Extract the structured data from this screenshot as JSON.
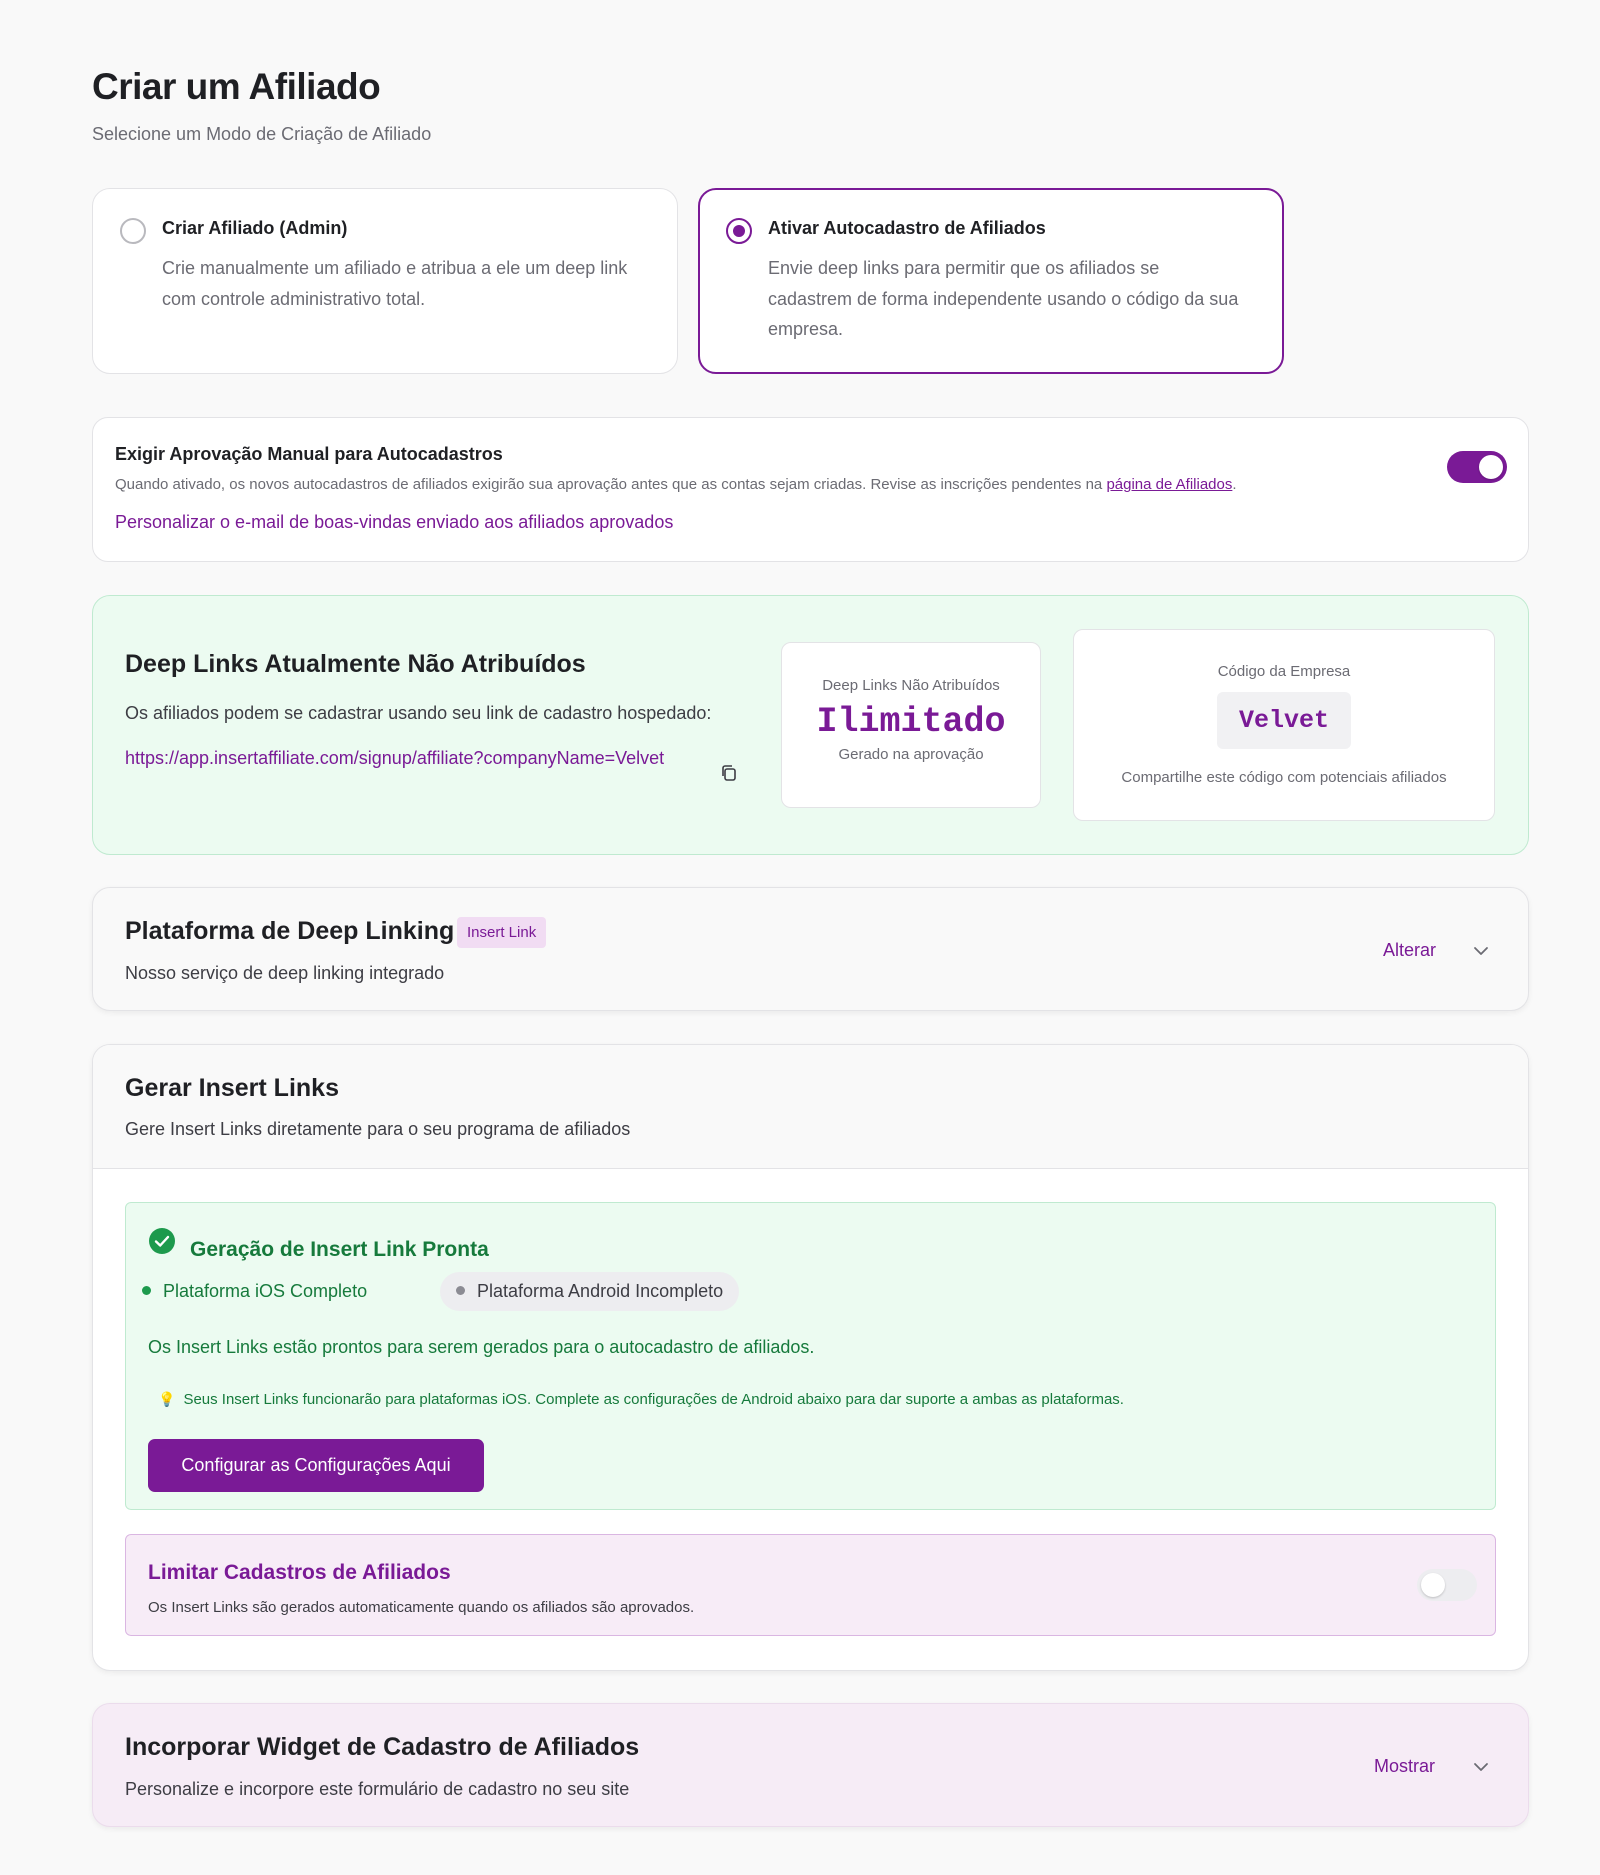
{
  "page": {
    "title": "Criar um Afiliado",
    "subtitle": "Selecione um Modo de Criação de Afiliado"
  },
  "modes": [
    {
      "title": "Criar Afiliado (Admin)",
      "description": "Crie manualmente um afiliado e atribua a ele um deep link com controle administrativo total.",
      "selected": false
    },
    {
      "title": "Ativar Autocadastro de Afiliados",
      "description": "Envie deep links para permitir que os afiliados se cadastrem de forma independente usando o código da sua empresa.",
      "selected": true
    }
  ],
  "approval": {
    "title": "Exigir Aprovação Manual para Autocadastros",
    "description": "Quando ativado, os novos autocadastros de afiliados exigirão sua aprovação antes que as contas sejam criadas. Revise as inscrições pendentes na ",
    "description_link": "página de Afiliados",
    "description_end": ".",
    "customize_link": "Personalizar o e-mail de boas-vindas enviado aos afiliados aprovados",
    "toggle_on": true
  },
  "deep_links": {
    "title": "Deep Links Atualmente Não Atribuídos",
    "description": "Os afiliados podem se cadastrar usando seu link de cadastro hospedado:",
    "signup_url": "https://app.insertaffiliate.com/signup/affiliate?companyName=Velvet",
    "unassigned_label": "Deep Links Não Atribuídos",
    "unassigned_value": "Ilimitado",
    "unassigned_note": "Gerado na aprovação",
    "company_code_label": "Código da Empresa",
    "company_code": "Velvet",
    "company_code_note": "Compartilhe este código com potenciais afiliados"
  },
  "platform": {
    "title": "Plataforma de Deep Linking",
    "badge": "Insert Link",
    "description": "Nosso serviço de deep linking integrado",
    "action": "Alterar"
  },
  "generate": {
    "title": "Gerar Insert Links",
    "description": "Gere Insert Links diretamente para o seu programa de afiliados",
    "ready_title": "Geração de Insert Link Pronta",
    "ios_status": "Plataforma iOS Completo",
    "android_status": "Plataforma Android Incompleto",
    "ready_description": "Os Insert Links estão prontos para serem gerados para o autocadastro de afiliados.",
    "tip_icon": "💡",
    "tip": "Seus Insert Links funcionarão para plataformas iOS. Complete as configurações de Android abaixo para dar suporte a ambas as plataformas.",
    "configure_button": "Configurar as Configurações Aqui",
    "limit_title": "Limitar Cadastros de Afiliados",
    "limit_description": "Os Insert Links são gerados automaticamente quando os afiliados são aprovados.",
    "limit_toggle_on": false
  },
  "widget": {
    "title": "Incorporar Widget de Cadastro de Afiliados",
    "description": "Personalize e incorpore este formulário de cadastro no seu site",
    "action": "Mostrar"
  },
  "colors": {
    "accent": "#7a1a96",
    "success": "#167a3c",
    "success_bg": "#ecfbf1",
    "accent_bg": "#f7ecf7"
  },
  "icons": {
    "copy": "copy-icon",
    "chevron": "chevron-down-icon",
    "check": "check-circle-icon",
    "tip": "lightbulb-icon"
  }
}
